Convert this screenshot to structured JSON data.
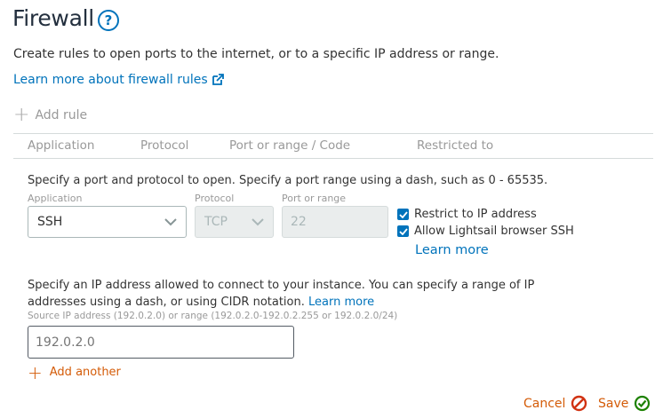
{
  "header": {
    "title": "Firewall",
    "help_icon": "?"
  },
  "description": "Create rules to open ports to the internet, or to a specific IP address or range.",
  "learn_link": "Learn more about firewall rules",
  "add_rule_label": "Add rule",
  "table": {
    "columns": [
      "Application",
      "Protocol",
      "Port or range / Code",
      "Restricted to"
    ]
  },
  "rule_form": {
    "instruction": "Specify a port and protocol to open. Specify a port range using a dash, such as 0 - 65535.",
    "application": {
      "label": "Application",
      "value": "SSH"
    },
    "protocol": {
      "label": "Protocol",
      "value": "TCP"
    },
    "port": {
      "label": "Port or range",
      "value": "22"
    },
    "restrict_ip": {
      "label": "Restrict to IP address",
      "checked": true
    },
    "allow_ssh": {
      "label": "Allow Lightsail browser SSH",
      "checked": true
    },
    "learn_more": "Learn more"
  },
  "ip_section": {
    "description": "Specify an IP address allowed to connect to your instance. You can specify a range of IP addresses using a dash, or using CIDR notation.",
    "learn_more": "Learn more",
    "hint": "Source IP address (192.0.2.0) or range (192.0.2.0-192.0.2.255 or 192.0.2.0/24)",
    "placeholder": "192.0.2.0",
    "add_another": "Add another"
  },
  "actions": {
    "cancel": "Cancel",
    "save": "Save"
  },
  "colors": {
    "link": "#0073bb",
    "action": "#d45b07",
    "cancel_icon": "#d13212",
    "save_icon": "#1d8102"
  },
  "icons": {
    "help": "question-circle-icon",
    "external": "external-link-icon",
    "add": "plus-icon",
    "cancel": "cancel-circle-icon",
    "save": "check-circle-icon"
  }
}
